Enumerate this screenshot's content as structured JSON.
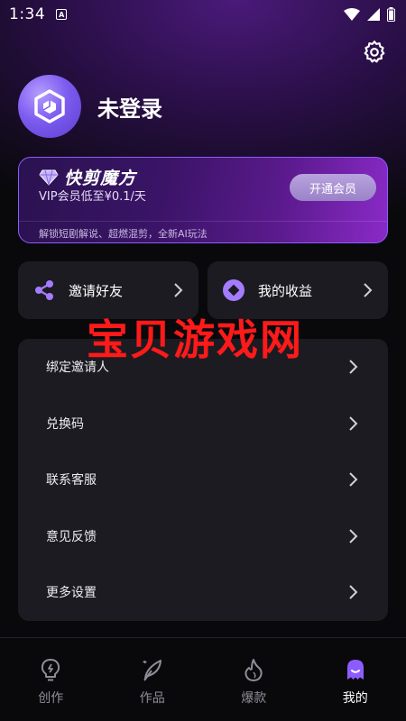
{
  "status_bar": {
    "time": "1:34",
    "notif_letter": "A"
  },
  "profile": {
    "username": "未登录"
  },
  "vip": {
    "brand": "快剪魔方",
    "price_text": "VIP会员低至¥0.1/天",
    "open_button": "开通会员",
    "description": "解锁短剧解说、超燃混剪，全新AI玩法"
  },
  "quick_cards": {
    "invite": "邀请好友",
    "earnings": "我的收益"
  },
  "watermark": "宝贝游戏网",
  "menu": [
    {
      "label": "绑定邀请人"
    },
    {
      "label": "兑换码"
    },
    {
      "label": "联系客服"
    },
    {
      "label": "意见反馈"
    },
    {
      "label": "更多设置"
    }
  ],
  "tabs": [
    {
      "label": "创作",
      "icon": "bulb-icon"
    },
    {
      "label": "作品",
      "icon": "feather-icon"
    },
    {
      "label": "爆款",
      "icon": "flame-icon"
    },
    {
      "label": "我的",
      "icon": "ghost-icon"
    }
  ],
  "colors": {
    "accent": "#8d5cff",
    "card": "#1c1b22",
    "background": "#09090c"
  }
}
